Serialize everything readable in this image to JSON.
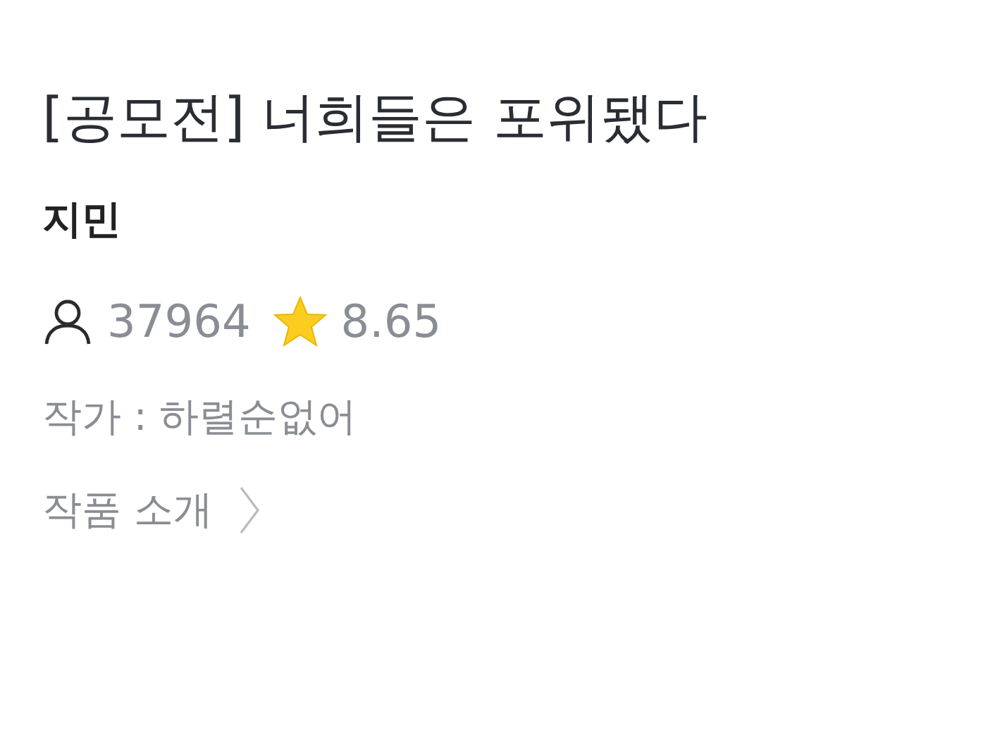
{
  "title": "[공모전] 너희들은 포위됐다",
  "subtitle": "지민",
  "stats": {
    "views": "37964",
    "rating": "8.65"
  },
  "author_line": "작가 : 하렬순없어",
  "intro_link": {
    "label": "작품 소개"
  }
}
